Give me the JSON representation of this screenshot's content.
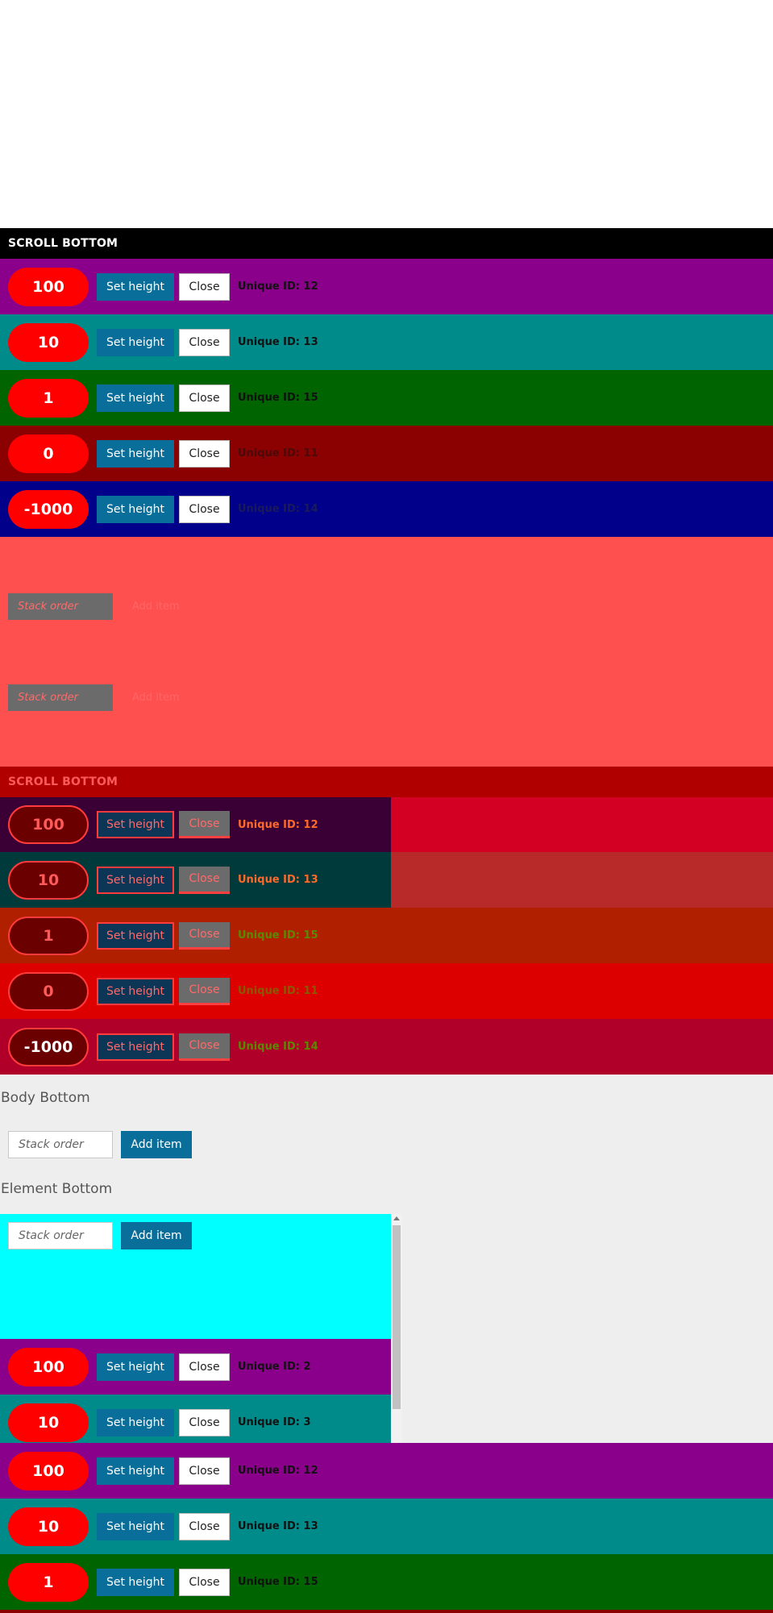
{
  "scroll_title": "SCROLL BOTTOM",
  "buttons": {
    "set_height": "Set height",
    "close": "Close",
    "add_item": "Add item"
  },
  "stack_placeholder": "Stack order",
  "rows": [
    {
      "height_value": "100",
      "uid": "Unique ID: 12",
      "color": "#8b008b",
      "uid_color": "#111111"
    },
    {
      "height_value": "10",
      "uid": "Unique ID: 13",
      "color": "#008b8b",
      "uid_color": "#111111"
    },
    {
      "height_value": "1",
      "uid": "Unique ID: 15",
      "color": "#006400",
      "uid_color": "#111111"
    },
    {
      "height_value": "0",
      "uid": "Unique ID: 11",
      "color": "#8b0000",
      "uid_color": "#3a0a0a"
    },
    {
      "height_value": "-1000",
      "uid": "Unique ID: 14",
      "color": "#00008b",
      "uid_color": "#1a1a5a"
    }
  ],
  "overlay": {
    "ghost_input": "Stack order",
    "ghost_add": "Add item",
    "title": "SCROLL BOTTOM",
    "rows": [
      {
        "height_value": "100",
        "uid": "Unique ID: 12"
      },
      {
        "height_value": "10",
        "uid": "Unique ID: 13"
      },
      {
        "height_value": "1",
        "uid": "Unique ID: 15"
      },
      {
        "height_value": "0",
        "uid": "Unique ID: 11"
      },
      {
        "height_value": "-1000",
        "uid": "Unique ID: 14"
      }
    ]
  },
  "body_bottom": {
    "heading": "Body Bottom"
  },
  "element_bottom": {
    "heading": "Element Bottom",
    "rows": [
      {
        "height_value": "100",
        "uid": "Unique ID: 2"
      },
      {
        "height_value": "10",
        "uid": "Unique ID: 3"
      }
    ]
  },
  "bottom_rows": [
    {
      "height_value": "100",
      "uid": "Unique ID: 12"
    },
    {
      "height_value": "10",
      "uid": "Unique ID: 13"
    },
    {
      "height_value": "1",
      "uid": "Unique ID: 15"
    }
  ],
  "colors": {
    "purple": "#8b008b",
    "teal": "#008b8b",
    "green": "#006400",
    "darkred": "#8b0000",
    "navy": "#00008b",
    "salmon": "#ff5050",
    "crimson": "#b00000",
    "cyan": "#00ffff",
    "accent": "#0a6e9a",
    "pill": "#ff0000"
  }
}
